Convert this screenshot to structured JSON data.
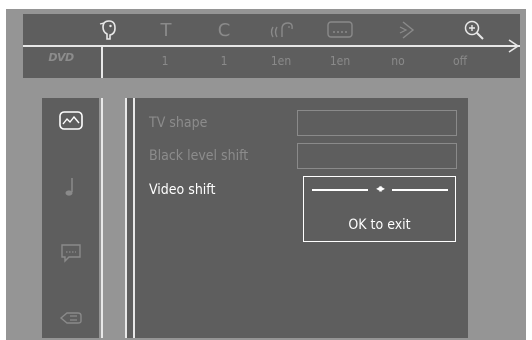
{
  "topbar": {
    "disc_logo": "DVD",
    "icons": [
      {
        "name": "user-preferences-icon",
        "glyph": "",
        "value": ""
      },
      {
        "name": "title-icon",
        "glyph": "T",
        "value": "1"
      },
      {
        "name": "chapter-icon",
        "glyph": "C",
        "value": "1"
      },
      {
        "name": "audio-language-icon",
        "glyph": "",
        "value": "1en"
      },
      {
        "name": "subtitle-icon",
        "glyph": "",
        "value": "1en"
      },
      {
        "name": "angle-icon",
        "glyph": "",
        "value": "no"
      },
      {
        "name": "zoom-icon",
        "glyph": "",
        "value": "off"
      }
    ]
  },
  "side": {
    "items": [
      {
        "name": "picture-settings-icon"
      },
      {
        "name": "sound-settings-icon"
      },
      {
        "name": "language-settings-icon"
      },
      {
        "name": "features-settings-icon"
      }
    ]
  },
  "menu": {
    "items": [
      {
        "label": "TV shape",
        "state": "disabled"
      },
      {
        "label": "Black level shift",
        "state": "disabled"
      },
      {
        "label": "Video shift",
        "state": "active"
      }
    ],
    "popup": {
      "slider_glyph": "◂▸",
      "exit_label": "OK to exit"
    }
  },
  "colors": {
    "panel": "#5e5e5e",
    "background": "#959595",
    "active_text": "#ffffff",
    "disabled_text": "#8c8c8c"
  }
}
